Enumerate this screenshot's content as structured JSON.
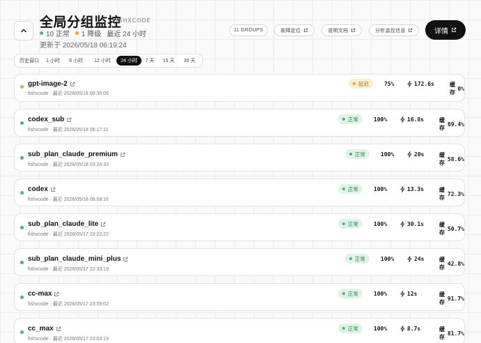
{
  "header": {
    "title": "全局分组监控",
    "brand": "FISHXCODE",
    "normal_count": "10 正常",
    "degraded_count": "1 降级",
    "window": "最近 24 小时",
    "updated": "更新于 2026/05/18 06:19:24",
    "groups_label": "11 GROUPS",
    "locate_label": "故障定位",
    "docs_label": "说明文档",
    "analysis_label": "分析监控信息",
    "details_label": "详情",
    "colors": {
      "normal": "#4caf7a",
      "degraded": "#e6a23c"
    }
  },
  "ranges": [
    {
      "label": "历史窗口",
      "active": false
    },
    {
      "label": "1 小时",
      "active": false
    },
    {
      "label": "6 小时",
      "active": false
    },
    {
      "label": "12 小时",
      "active": false
    },
    {
      "label": "24 小时",
      "active": true
    },
    {
      "label": "7 天",
      "active": false
    },
    {
      "label": "15 天",
      "active": false
    },
    {
      "label": "30 天",
      "active": false
    }
  ],
  "cache_label": "缓存",
  "groups": [
    {
      "name": "gpt-image-2",
      "meta": "fishxcode · 最近 2026/05/18 00:35:06",
      "status": "延迟",
      "kind": "delay",
      "uptime": "75%",
      "latency": "172.6s",
      "cache": "0%"
    },
    {
      "name": "codex_sub",
      "meta": "fishxcode · 最近 2026/05/18 06:17:11",
      "status": "正常",
      "kind": "ok",
      "uptime": "100%",
      "latency": "16.8s",
      "cache": "89.4%"
    },
    {
      "name": "sub_plan_claude_premium",
      "meta": "fishxcode · 最近 2026/05/18 03:24:32",
      "status": "正常",
      "kind": "ok",
      "uptime": "100%",
      "latency": "20s",
      "cache": "58.6%"
    },
    {
      "name": "codex",
      "meta": "fishxcode · 最近 2026/05/18 06:08:16",
      "status": "正常",
      "kind": "ok",
      "uptime": "100%",
      "latency": "13.3s",
      "cache": "72.3%"
    },
    {
      "name": "sub_plan_claude_lite",
      "meta": "fishxcode · 最近 2026/05/17 23:22:22",
      "status": "正常",
      "kind": "ok",
      "uptime": "100%",
      "latency": "30.1s",
      "cache": "50.7%"
    },
    {
      "name": "sub_plan_claude_mini_plus",
      "meta": "fishxcode · 最近 2026/05/17 22:33:19",
      "status": "正常",
      "kind": "ok",
      "uptime": "100%",
      "latency": "24s",
      "cache": "42.8%"
    },
    {
      "name": "cc-max",
      "meta": "fishxcode · 最近 2026/05/17 23:59:02",
      "status": "正常",
      "kind": "ok",
      "uptime": "100%",
      "latency": "12s",
      "cache": "91.7%"
    },
    {
      "name": "cc_max",
      "meta": "fishxcode · 最近 2026/05/17 23:03:19",
      "status": "正常",
      "kind": "ok",
      "uptime": "100%",
      "latency": "8.7s",
      "cache": "81.7%"
    }
  ]
}
